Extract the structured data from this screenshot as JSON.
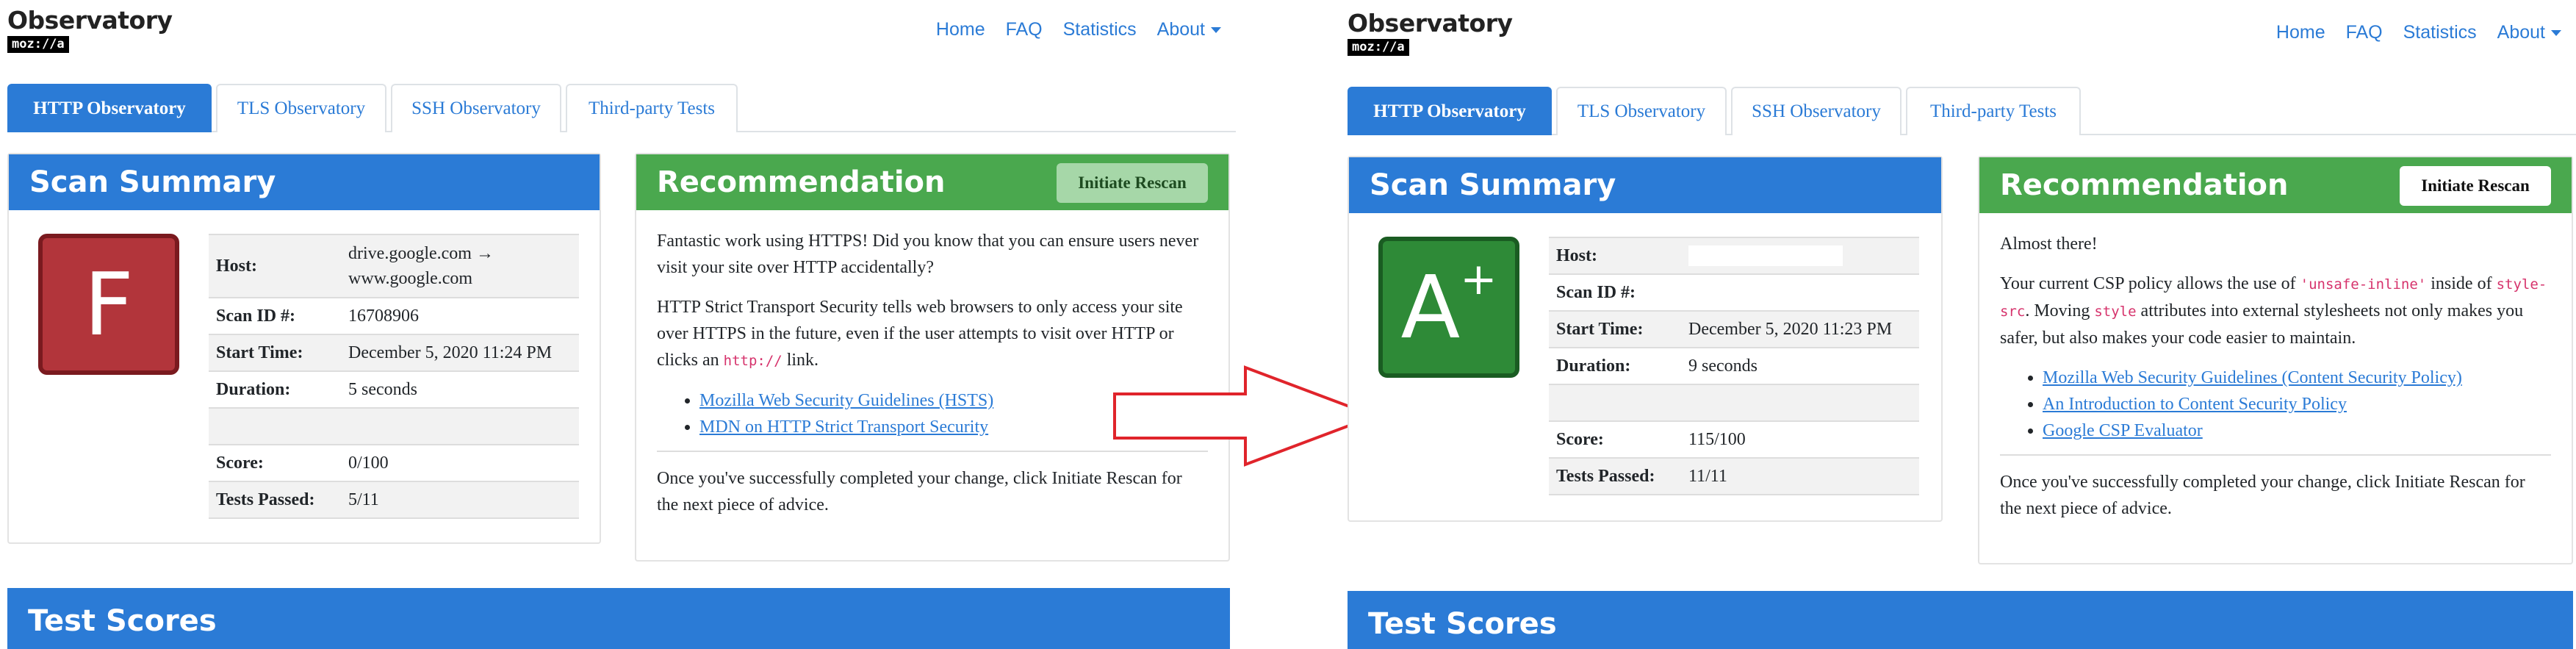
{
  "brand": {
    "title": "Observatory",
    "logo_text": "moz://a"
  },
  "nav": {
    "home": "Home",
    "faq": "FAQ",
    "statistics": "Statistics",
    "about": "About"
  },
  "tabs": [
    "HTTP Observatory",
    "TLS Observatory",
    "SSH Observatory",
    "Third-party Tests"
  ],
  "scan_summary_title": "Scan Summary",
  "recommendation_title": "Recommendation",
  "rescan_label": "Initiate Rescan",
  "test_scores_title": "Test Scores",
  "labels": {
    "host": "Host:",
    "scan_id": "Scan ID #:",
    "start_time": "Start Time:",
    "duration": "Duration:",
    "score": "Score:",
    "tests_passed": "Tests Passed:"
  },
  "before": {
    "grade": "F",
    "grade_color": "#b2353b",
    "host_line1": "drive.google.com →",
    "host_line2": "www.google.com",
    "scan_id": "16708906",
    "start_time": "December 5, 2020 11:24 PM",
    "duration": "5 seconds",
    "score": "0/100",
    "tests_passed": "5/11",
    "rec_p1": "Fantastic work using HTTPS! Did you know that you can ensure users never visit your site over HTTP accidentally?",
    "rec_p2_a": "HTTP Strict Transport Security tells web browsers to only access your site over HTTPS in the future, even if the user attempts to visit over HTTP or clicks an ",
    "rec_p2_code": "http://",
    "rec_p2_b": " link.",
    "links": [
      "Mozilla Web Security Guidelines (HSTS)",
      "MDN on HTTP Strict Transport Security"
    ],
    "footer": "Once you've successfully completed your change, click Initiate Rescan for the next piece of advice."
  },
  "after": {
    "grade": "A",
    "grade_plus": "+",
    "grade_color": "#2e8a37",
    "scan_id": "",
    "start_time": "December 5, 2020 11:23 PM",
    "duration": "9 seconds",
    "score": "115/100",
    "tests_passed": "11/11",
    "rec_p1": "Almost there!",
    "rec_p2_a": "Your current CSP policy allows the use of ",
    "rec_p2_code1": "'unsafe-inline'",
    "rec_p2_b": " inside of ",
    "rec_p2_code2": "style-src",
    "rec_p2_c": ". Moving ",
    "rec_p2_code3": "style",
    "rec_p2_d": " attributes into external stylesheets not only makes you safer, but also makes your code easier to maintain.",
    "links": [
      "Mozilla Web Security Guidelines (Content Security Policy)",
      "An Introduction to Content Security Policy",
      "Google CSP Evaluator"
    ],
    "footer": "Once you've successfully completed your change, click Initiate Rescan for the next piece of advice."
  },
  "colors": {
    "accent_blue": "#2b7bd6",
    "recommend_green": "#4aa84e",
    "arrow_red": "#e0242b"
  }
}
